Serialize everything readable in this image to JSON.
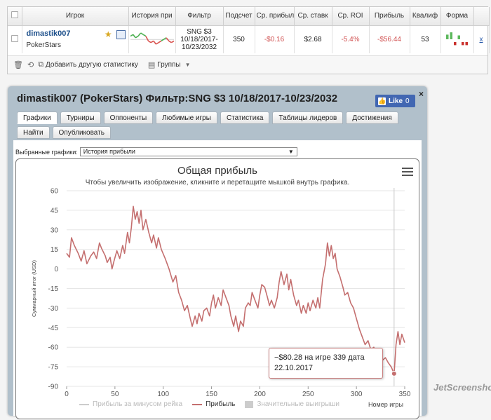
{
  "stats_table": {
    "headers": [
      "Игрок",
      "История при",
      "Фильтр",
      "Подсчет",
      "Ср. прибыль",
      "Ср. ставк",
      "Ср. ROI",
      "Прибыль",
      "Квалиф",
      "Форма"
    ],
    "row": {
      "player_name": "dimastik007",
      "site": "PokerStars",
      "filter_lines": [
        "SNG $3",
        "10/18/2017-",
        "10/23/2032"
      ],
      "count": "350",
      "avg_profit": "-$0.16",
      "avg_stake": "$2.68",
      "avg_roi": "-5.4%",
      "profit": "-$56.44",
      "qualif": "53",
      "remove": "x"
    },
    "sparkline_values": [
      2,
      3,
      1,
      2,
      4,
      3,
      2,
      -1,
      -2,
      -1,
      -3,
      -2,
      -1,
      0,
      1,
      -1,
      -2,
      -1
    ],
    "form_bars": [
      {
        "color": "#5cb85c",
        "value": 0.6
      },
      {
        "color": "#5cb85c",
        "value": 0.9
      },
      {
        "color": "#c9302c",
        "value": -0.4
      },
      {
        "color": "#5cb85c",
        "value": 0.5
      },
      {
        "color": "#c9302c",
        "value": -0.4
      },
      {
        "color": "#c9302c",
        "value": -0.4
      }
    ]
  },
  "bottom_bar": {
    "add_stat_label": "Добавить другую статистику",
    "groups_label": "Группы"
  },
  "panel": {
    "title": "dimastik007 (PokerStars) Фильтр:SNG $3 10/18/2017-10/23/2032",
    "like_label": "Like",
    "like_count": "0",
    "close": "×",
    "tabs_row1": [
      "Графики",
      "Турниры",
      "Оппоненты",
      "Любимые игры",
      "Статистика",
      "Таблицы лидеров",
      "Достижения"
    ],
    "tabs_row2": [
      "Найти",
      "Опубликовать"
    ],
    "selector_label": "Выбранные графики:",
    "selector_value": "История прибыли"
  },
  "chart_data": {
    "type": "line",
    "title": "Общая прибыль",
    "subtitle": "Чтобы увеличить изображение, кликните и перетащите мышкой внутрь графика.",
    "ylabel": "Суммарный итог (USD)",
    "xlabel": "Номер игры",
    "xlim": [
      0,
      350
    ],
    "ylim": [
      -90,
      60
    ],
    "x_ticks": [
      0,
      50,
      100,
      150,
      200,
      250,
      300,
      350
    ],
    "y_ticks": [
      60,
      45,
      30,
      15,
      0,
      -15,
      -30,
      -45,
      -60,
      -75,
      -90
    ],
    "series": [
      {
        "name": "Прибыль",
        "color": "#c46f6f",
        "points": [
          [
            0,
            12
          ],
          [
            3,
            9
          ],
          [
            5,
            24
          ],
          [
            8,
            18
          ],
          [
            12,
            12
          ],
          [
            15,
            6
          ],
          [
            18,
            14
          ],
          [
            21,
            4
          ],
          [
            25,
            10
          ],
          [
            28,
            13
          ],
          [
            31,
            8
          ],
          [
            34,
            20
          ],
          [
            36,
            16
          ],
          [
            40,
            10
          ],
          [
            42,
            5
          ],
          [
            45,
            9
          ],
          [
            47,
            0
          ],
          [
            49,
            6
          ],
          [
            52,
            14
          ],
          [
            55,
            8
          ],
          [
            58,
            18
          ],
          [
            60,
            12
          ],
          [
            63,
            28
          ],
          [
            65,
            20
          ],
          [
            67,
            32
          ],
          [
            69,
            48
          ],
          [
            71,
            38
          ],
          [
            73,
            44
          ],
          [
            75,
            35
          ],
          [
            77,
            45
          ],
          [
            79,
            30
          ],
          [
            82,
            38
          ],
          [
            85,
            28
          ],
          [
            88,
            20
          ],
          [
            90,
            26
          ],
          [
            93,
            16
          ],
          [
            95,
            24
          ],
          [
            98,
            15
          ],
          [
            102,
            8
          ],
          [
            106,
            0
          ],
          [
            110,
            -10
          ],
          [
            113,
            -5
          ],
          [
            116,
            -18
          ],
          [
            119,
            -24
          ],
          [
            122,
            -32
          ],
          [
            125,
            -28
          ],
          [
            128,
            -38
          ],
          [
            130,
            -44
          ],
          [
            133,
            -36
          ],
          [
            135,
            -42
          ],
          [
            137,
            -34
          ],
          [
            140,
            -40
          ],
          [
            142,
            -32
          ],
          [
            145,
            -30
          ],
          [
            148,
            -36
          ],
          [
            150,
            -26
          ],
          [
            152,
            -20
          ],
          [
            154,
            -30
          ],
          [
            157,
            -22
          ],
          [
            160,
            -28
          ],
          [
            162,
            -16
          ],
          [
            165,
            -22
          ],
          [
            168,
            -28
          ],
          [
            170,
            -36
          ],
          [
            173,
            -44
          ],
          [
            175,
            -36
          ],
          [
            178,
            -48
          ],
          [
            180,
            -40
          ],
          [
            183,
            -44
          ],
          [
            185,
            -30
          ],
          [
            188,
            -26
          ],
          [
            190,
            -28
          ],
          [
            192,
            -18
          ],
          [
            195,
            -24
          ],
          [
            198,
            -30
          ],
          [
            200,
            -20
          ],
          [
            202,
            -12
          ],
          [
            205,
            -14
          ],
          [
            208,
            -22
          ],
          [
            210,
            -28
          ],
          [
            212,
            -24
          ],
          [
            215,
            -30
          ],
          [
            218,
            -22
          ],
          [
            220,
            -10
          ],
          [
            222,
            -2
          ],
          [
            225,
            -12
          ],
          [
            228,
            -4
          ],
          [
            230,
            -16
          ],
          [
            232,
            -8
          ],
          [
            235,
            -20
          ],
          [
            238,
            -28
          ],
          [
            240,
            -24
          ],
          [
            243,
            -34
          ],
          [
            245,
            -28
          ],
          [
            248,
            -34
          ],
          [
            250,
            -26
          ],
          [
            252,
            -32
          ],
          [
            255,
            -24
          ],
          [
            258,
            -30
          ],
          [
            260,
            -22
          ],
          [
            262,
            -30
          ],
          [
            265,
            -8
          ],
          [
            268,
            4
          ],
          [
            270,
            20
          ],
          [
            272,
            10
          ],
          [
            274,
            18
          ],
          [
            276,
            8
          ],
          [
            278,
            12
          ],
          [
            280,
            0
          ],
          [
            283,
            -6
          ],
          [
            286,
            -14
          ],
          [
            288,
            -20
          ],
          [
            291,
            -18
          ],
          [
            294,
            -26
          ],
          [
            297,
            -30
          ],
          [
            300,
            -38
          ],
          [
            303,
            -46
          ],
          [
            306,
            -52
          ],
          [
            309,
            -58
          ],
          [
            312,
            -55
          ],
          [
            315,
            -62
          ],
          [
            318,
            -60
          ],
          [
            321,
            -66
          ],
          [
            324,
            -62
          ],
          [
            327,
            -70
          ],
          [
            330,
            -68
          ],
          [
            333,
            -72
          ],
          [
            336,
            -75
          ],
          [
            339,
            -80.28
          ],
          [
            341,
            -58
          ],
          [
            343,
            -48
          ],
          [
            345,
            -58
          ],
          [
            347,
            -50
          ],
          [
            350,
            -56.44
          ]
        ]
      }
    ],
    "highlight": {
      "x": 339,
      "y": -80.28
    },
    "tooltip_lines": [
      "−$80.28 на игре 339 дата",
      "22.10.2017"
    ],
    "legend": [
      {
        "name": "Прибыль за минусом рейка",
        "type": "line",
        "color": "#cccccc",
        "active": false
      },
      {
        "name": "Прибыль",
        "type": "line",
        "color": "#c46f6f",
        "active": true
      },
      {
        "name": "Значительные выигрыши",
        "type": "box",
        "color": "#cccccc",
        "active": false
      }
    ]
  },
  "watermark": "JetScreenshot"
}
